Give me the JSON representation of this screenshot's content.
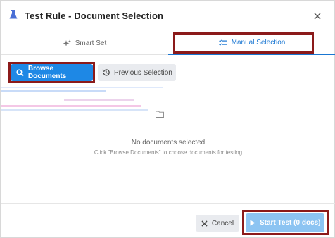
{
  "dialog": {
    "title": "Test Rule - Document Selection",
    "app_icon": "flask-icon",
    "close_icon": "close-icon"
  },
  "tabs": [
    {
      "label": "Smart Set",
      "icon": "sparkle-icon",
      "active": false
    },
    {
      "label": "Manual Selection",
      "icon": "checklist-icon",
      "active": true
    }
  ],
  "actions": {
    "browse_label": "Browse Documents",
    "browse_icon": "search-icon",
    "previous_label": "Previous Selection",
    "previous_icon": "history-icon"
  },
  "empty_state": {
    "title": "No documents selected",
    "hint": "Click \"Browse Documents\" to choose documents for testing"
  },
  "footer": {
    "cancel_label": "Cancel",
    "start_label": "Start Test (0 docs)"
  },
  "colors": {
    "accent": "#1e88e5",
    "accent_disabled": "#8cc4f2",
    "highlight_box": "#8b1a1a",
    "secondary_button": "#e9ebef"
  }
}
